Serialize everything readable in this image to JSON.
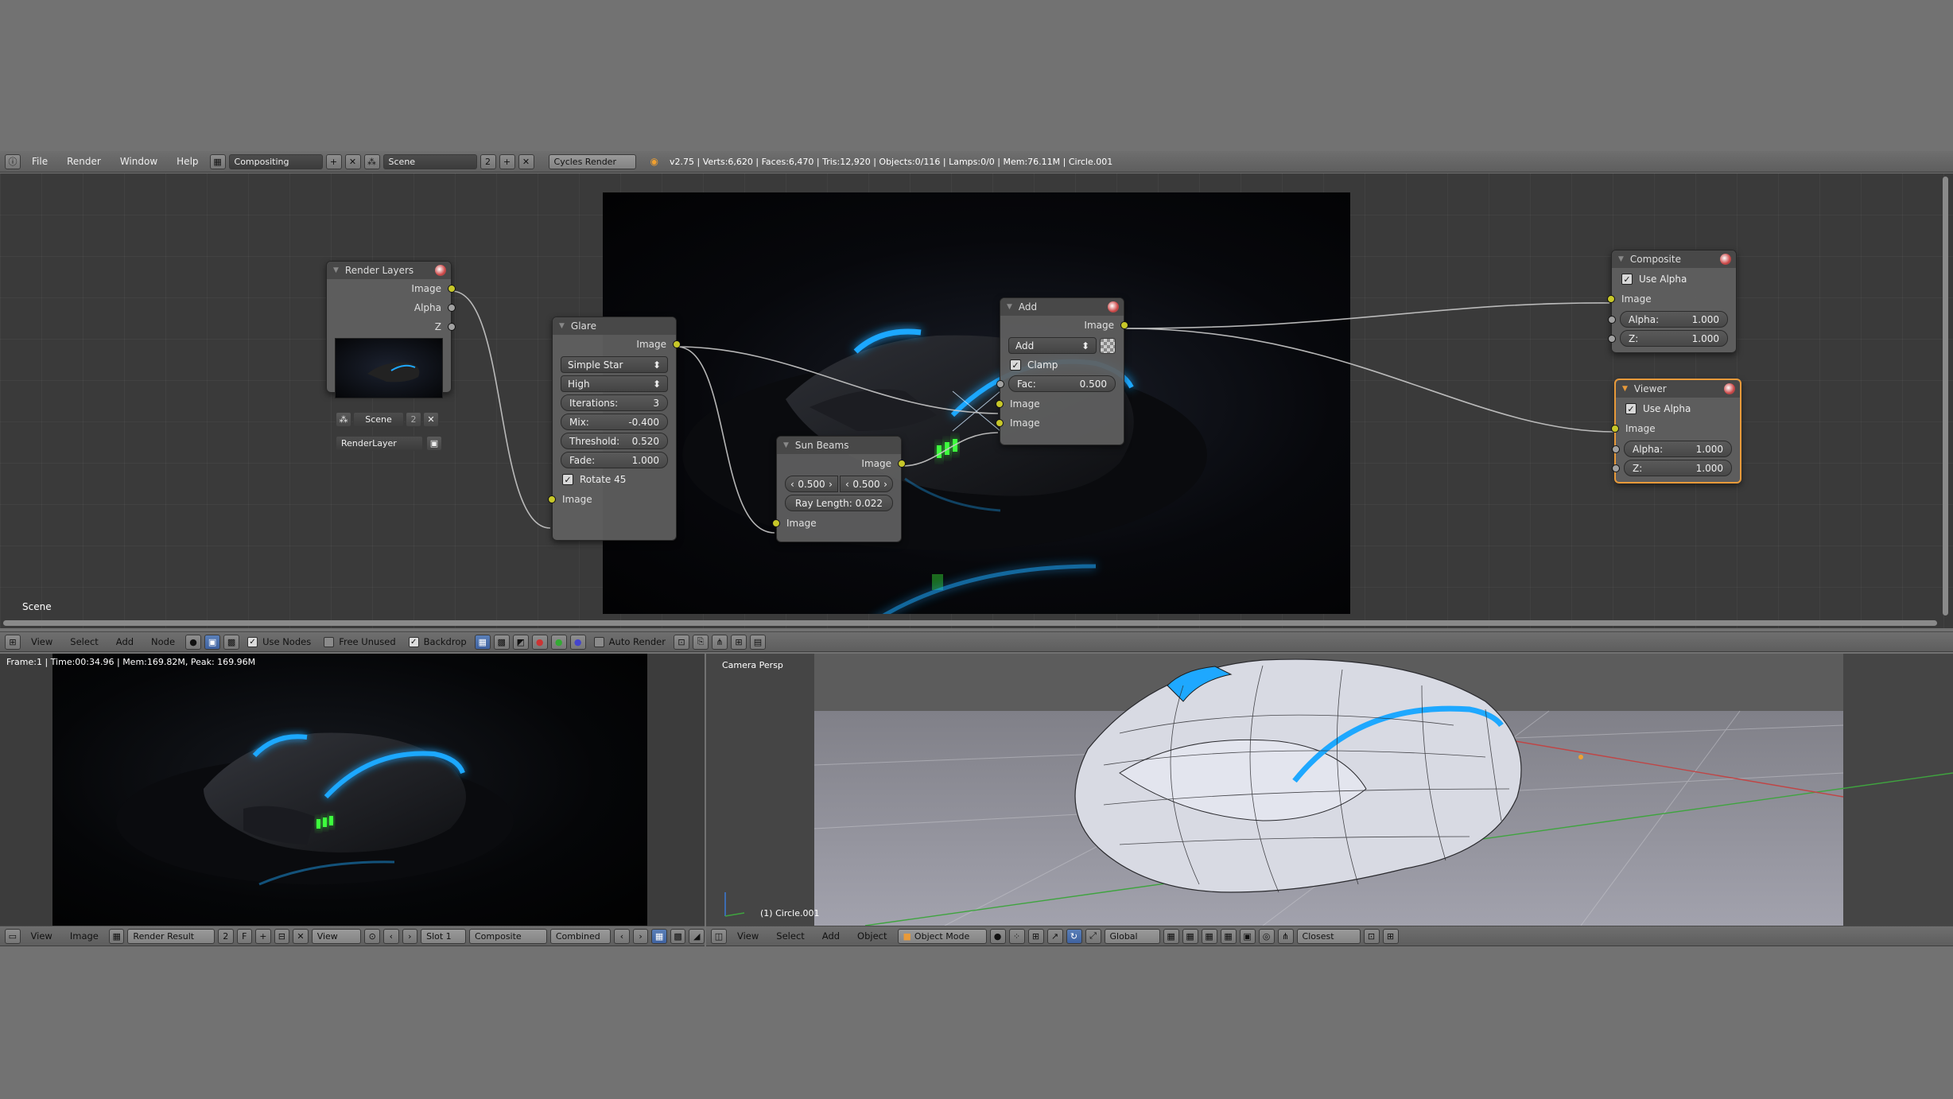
{
  "topbar": {
    "menus": [
      "File",
      "Render",
      "Window",
      "Help"
    ],
    "screen_layout": "Compositing",
    "scene": "Scene",
    "scene_users": "2",
    "render_engine": "Cycles Render",
    "stats": "v2.75 | Verts:6,620 | Faces:6,470 | Tris:12,920 | Objects:0/116 | Lamps:0/0 | Mem:76.11M | Circle.001"
  },
  "node_editor": {
    "scene_label": "Scene",
    "render_layers": {
      "title": "Render Layers",
      "outputs": [
        "Image",
        "Alpha",
        "Z"
      ],
      "scene": "Scene",
      "scene_users": "2",
      "layer": "RenderLayer"
    },
    "glare": {
      "title": "Glare",
      "output": "Image",
      "type": "Simple Star",
      "quality": "High",
      "iterations_label": "Iterations:",
      "iterations": "3",
      "mix_label": "Mix:",
      "mix": "-0.400",
      "threshold_label": "Threshold:",
      "threshold": "0.520",
      "fade_label": "Fade:",
      "fade": "1.000",
      "rotate_label": "Rotate 45",
      "input": "Image"
    },
    "sun_beams": {
      "title": "Sun Beams",
      "output": "Image",
      "source_x": "0.500",
      "source_y": "0.500",
      "ray_length": "Ray Length: 0.022",
      "input": "Image"
    },
    "add": {
      "title": "Add",
      "output": "Image",
      "blend": "Add",
      "clamp_label": "Clamp",
      "fac_label": "Fac:",
      "fac": "0.500",
      "inputs": [
        "Image",
        "Image"
      ]
    },
    "composite": {
      "title": "Composite",
      "use_alpha": "Use Alpha",
      "input": "Image",
      "alpha_label": "Alpha:",
      "alpha": "1.000",
      "z_label": "Z:",
      "z": "1.000"
    },
    "viewer": {
      "title": "Viewer",
      "use_alpha": "Use Alpha",
      "input": "Image",
      "alpha_label": "Alpha:",
      "alpha": "1.000",
      "z_label": "Z:",
      "z": "1.000"
    }
  },
  "node_header": {
    "menus": [
      "View",
      "Select",
      "Add",
      "Node"
    ],
    "use_nodes": "Use Nodes",
    "free_unused": "Free Unused",
    "backdrop": "Backdrop",
    "auto_render": "Auto Render"
  },
  "image_editor": {
    "frame_info": "Frame:1 | Time:00:34.96 | Mem:169.82M, Peak: 169.96M",
    "menus": [
      "View",
      "Image"
    ],
    "image_name": "Render Result",
    "users": "2",
    "fake": "F",
    "view": "View",
    "slot": "Slot 1",
    "layer": "Composite",
    "pass": "Combined"
  },
  "viewport": {
    "camera_label": "Camera Persp",
    "object_label": "(1) Circle.001",
    "menus": [
      "View",
      "Select",
      "Add",
      "Object"
    ],
    "mode": "Object Mode",
    "orientation": "Global",
    "snap": "Closest"
  },
  "colors": {
    "glow_blue": "#1ea8ff",
    "led_green": "#3cff3c",
    "socket_yellow": "#c7c729",
    "active_node_border": "#e89a3a"
  }
}
